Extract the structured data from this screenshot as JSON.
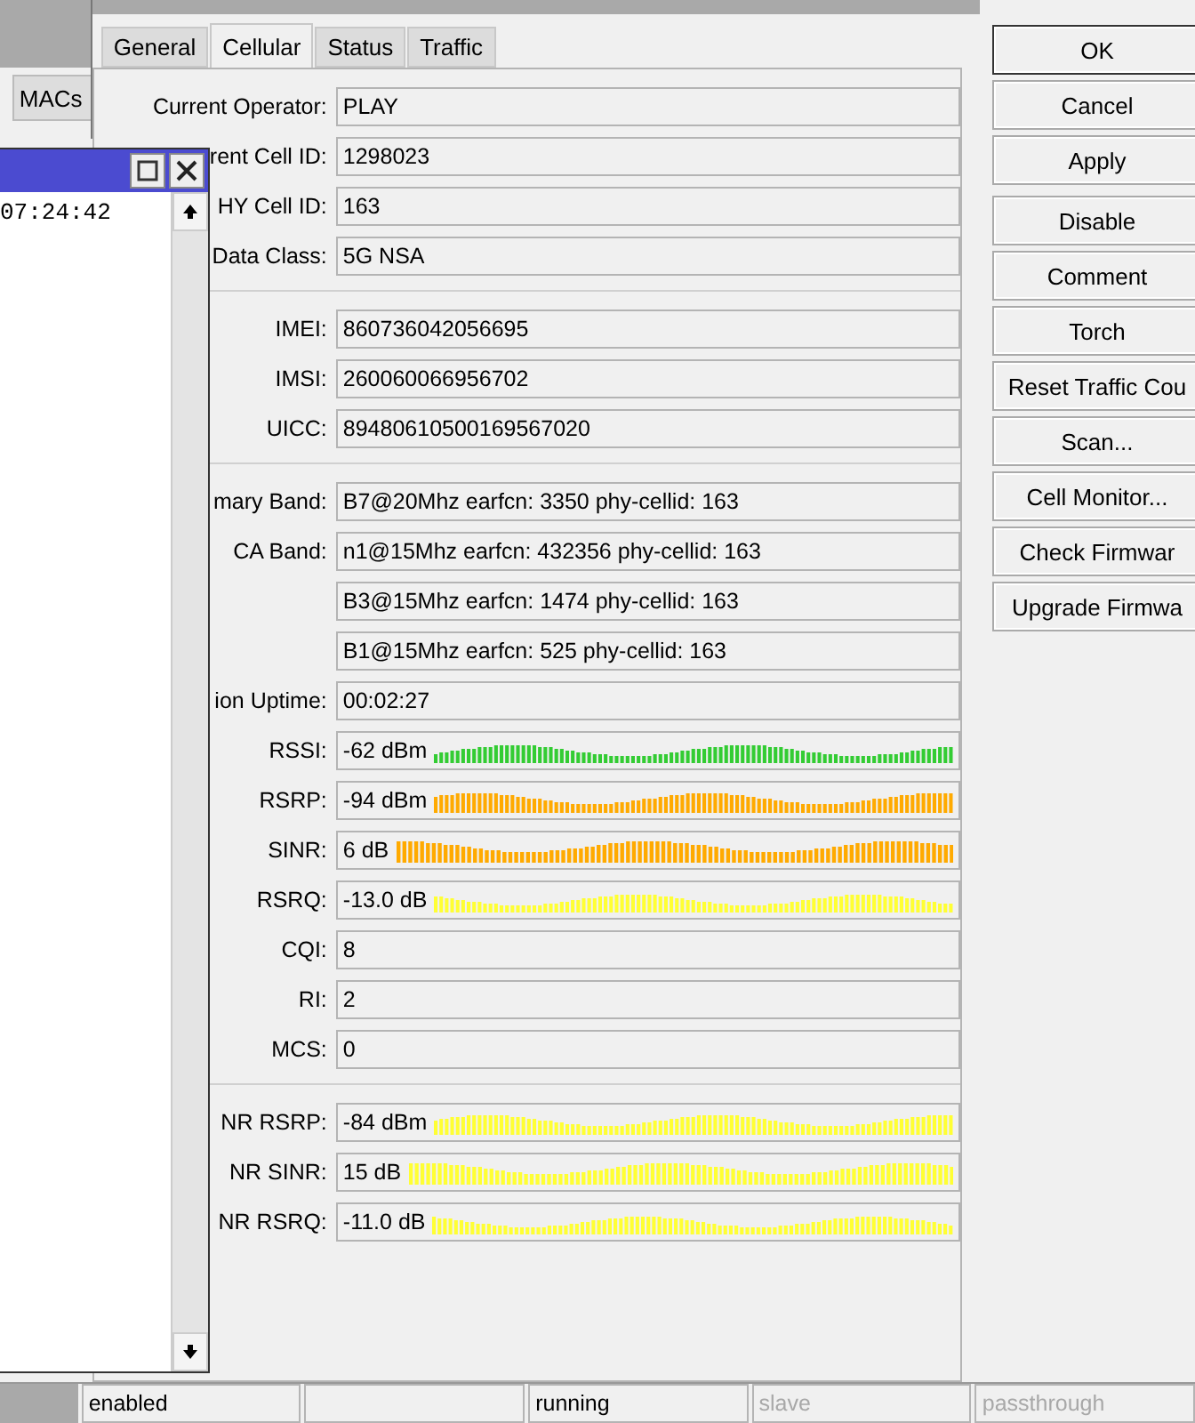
{
  "background_window": {
    "tab": "MACs"
  },
  "log_window": {
    "line": "07:24:42"
  },
  "dialog": {
    "tabs": [
      {
        "label": "General",
        "selected": false
      },
      {
        "label": "Cellular",
        "selected": true
      },
      {
        "label": "Status",
        "selected": false
      },
      {
        "label": "Traffic",
        "selected": false
      }
    ],
    "groups": [
      {
        "rows": [
          {
            "kind": "text",
            "label": "Current Operator:",
            "value": "PLAY"
          },
          {
            "kind": "text",
            "label": "rent Cell ID:",
            "value": "1298023"
          },
          {
            "kind": "text",
            "label": "HY Cell ID:",
            "value": "163"
          },
          {
            "kind": "text",
            "label": "Data Class:",
            "value": "5G NSA"
          }
        ]
      },
      {
        "rows": [
          {
            "kind": "text",
            "label": "IMEI:",
            "value": "860736042056695"
          },
          {
            "kind": "text",
            "label": "IMSI:",
            "value": "260060066956702"
          },
          {
            "kind": "text",
            "label": "UICC:",
            "value": "89480610500169567020"
          }
        ]
      },
      {
        "rows": [
          {
            "kind": "text",
            "label": "mary Band:",
            "value": "B7@20Mhz earfcn: 3350 phy-cellid: 163"
          },
          {
            "kind": "text",
            "label": "CA Band:",
            "value": "n1@15Mhz earfcn: 432356 phy-cellid: 163"
          },
          {
            "kind": "text",
            "value": "B3@15Mhz earfcn: 1474 phy-cellid: 163"
          },
          {
            "kind": "text",
            "value": "B1@15Mhz earfcn: 525 phy-cellid: 163"
          },
          {
            "kind": "text",
            "label": "ion Uptime:",
            "value": "00:02:27"
          },
          {
            "kind": "graph",
            "label": "RSSI:",
            "value": "-62 dBm",
            "color": "#33cc33"
          },
          {
            "kind": "graph",
            "label": "RSRP:",
            "value": "-94 dBm",
            "color": "#ffaa00"
          },
          {
            "kind": "graph",
            "label": "SINR:",
            "value": "6 dB",
            "color": "#ffaa00"
          },
          {
            "kind": "graph",
            "label": "RSRQ:",
            "value": "-13.0 dB",
            "color": "#ffff33"
          },
          {
            "kind": "text",
            "label": "CQI:",
            "value": "8"
          },
          {
            "kind": "text",
            "label": "RI:",
            "value": "2"
          },
          {
            "kind": "text",
            "label": "MCS:",
            "value": "0"
          }
        ]
      },
      {
        "rows": [
          {
            "kind": "graph",
            "label": "NR RSRP:",
            "value": "-84 dBm",
            "color": "#ffff33"
          },
          {
            "kind": "graph",
            "label": "NR SINR:",
            "value": "15 dB",
            "color": "#ffff33"
          },
          {
            "kind": "graph",
            "label": "NR RSRQ:",
            "value": "-11.0 dB",
            "color": "#ffff33"
          }
        ]
      }
    ]
  },
  "buttons": [
    {
      "label": "OK",
      "default": true
    },
    {
      "label": "Cancel",
      "default": false
    },
    {
      "label": "Apply",
      "default": false
    },
    {
      "label": "Disable",
      "default": false
    },
    {
      "label": "Comment",
      "default": false
    },
    {
      "label": "Torch",
      "default": false
    },
    {
      "label": "Reset Traffic Cou",
      "default": false
    },
    {
      "label": "Scan...",
      "default": false
    },
    {
      "label": "Cell Monitor...",
      "default": false
    },
    {
      "label": "Check Firmwar",
      "default": false
    },
    {
      "label": "Upgrade Firmwa",
      "default": false
    }
  ],
  "status_bar": [
    {
      "text": "enabled",
      "disabled": false
    },
    {
      "text": "running",
      "disabled": false
    },
    {
      "text": "slave",
      "disabled": true
    },
    {
      "text": "passthrough",
      "disabled": true
    }
  ]
}
